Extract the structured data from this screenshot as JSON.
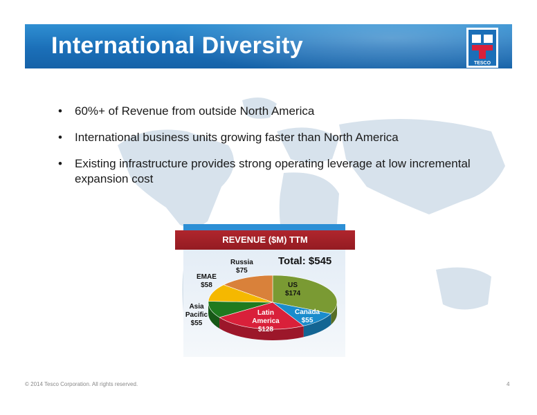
{
  "slide": {
    "title": "International Diversity",
    "bullets": [
      "60%+ of Revenue from outside North America",
      "International business units growing faster than North America",
      "Existing infrastructure provides strong operating leverage at low incremental expansion cost"
    ],
    "logo_text": "TESCO",
    "footer_copyright": "© 2014 Tesco Corporation. All rights reserved.",
    "page_number": "4"
  },
  "colors": {
    "header_blue": "#1b6fb8",
    "bar_red": "#a32028",
    "us": "#7a9a33",
    "canada": "#1a8ccc",
    "latin_america": "#d9203a",
    "asia_pacific": "#1f7a1f",
    "emae": "#f5b800",
    "russia": "#d9813a"
  },
  "chart_data": {
    "type": "pie",
    "title": "REVENUE ($M) TTM",
    "annotation": "Total: $545",
    "slices": [
      {
        "name": "US",
        "value": 174,
        "label": "$174"
      },
      {
        "name": "Canada",
        "value": 55,
        "label": "$55"
      },
      {
        "name": "Latin America",
        "value": 128,
        "label": "$128"
      },
      {
        "name": "Asia Pacific",
        "value": 55,
        "label": "$55"
      },
      {
        "name": "EMAE",
        "value": 58,
        "label": "$58"
      },
      {
        "name": "Russia",
        "value": 75,
        "label": "$75"
      }
    ]
  }
}
